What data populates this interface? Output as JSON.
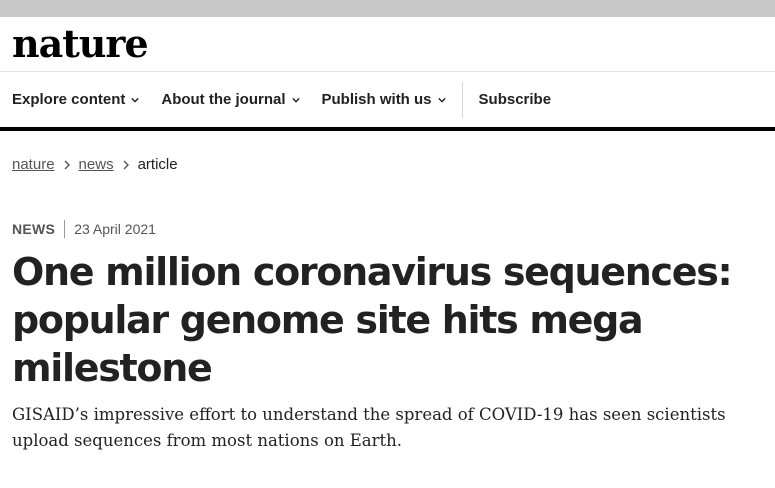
{
  "header": {
    "logo": "nature"
  },
  "nav": {
    "items": [
      {
        "label": "Explore content",
        "has_dropdown": true
      },
      {
        "label": "About the journal",
        "has_dropdown": true
      },
      {
        "label": "Publish with us",
        "has_dropdown": true
      }
    ],
    "subscribe": "Subscribe"
  },
  "breadcrumb": {
    "items": [
      "nature",
      "news"
    ],
    "current": "article"
  },
  "article": {
    "type": "NEWS",
    "date": "23 April 2021",
    "title": "One million coronavirus sequences: popular genome site hits mega milestone",
    "standfirst": "GISAID’s impressive effort to understand the spread of COVID-19 has seen scientists upload sequences from most nations on Earth."
  },
  "icons": {
    "dropdown": "chevron-down-icon",
    "breadcrumb_separator": "chevron-right-icon"
  },
  "colors": {
    "top_bar": "#c8c8c8",
    "nav_border": "#000000",
    "text": "#222222",
    "muted": "#555555"
  }
}
